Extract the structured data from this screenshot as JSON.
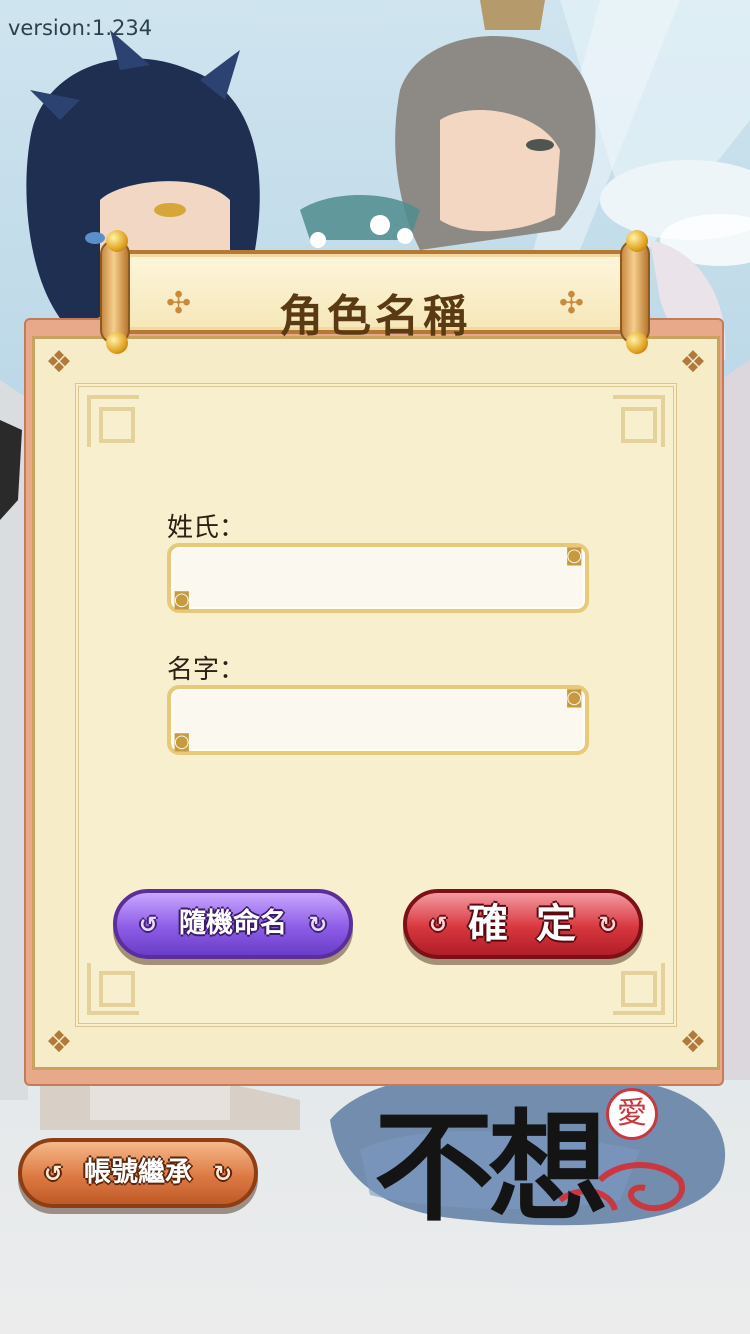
{
  "app": {
    "version": "version:1.234"
  },
  "dialog": {
    "title": "角色名稱",
    "surname_label": "姓氏：",
    "surname_value": "",
    "given_name_label": "名字：",
    "given_name_value": "",
    "random_button": "隨機命名",
    "confirm_button": "確定"
  },
  "footer": {
    "account_inherit_button": "帳號繼承",
    "logo_text": "不想",
    "logo_seal": "愛"
  },
  "icons": {
    "scroll_ornament": "lattice-ornament-icon",
    "button_swirl": "cloud-swirl-icon"
  },
  "colors": {
    "panel": "#f6ecc8",
    "random_button": "#8d5de6",
    "confirm_button": "#d8373f",
    "inherit_button": "#dd7a44"
  }
}
